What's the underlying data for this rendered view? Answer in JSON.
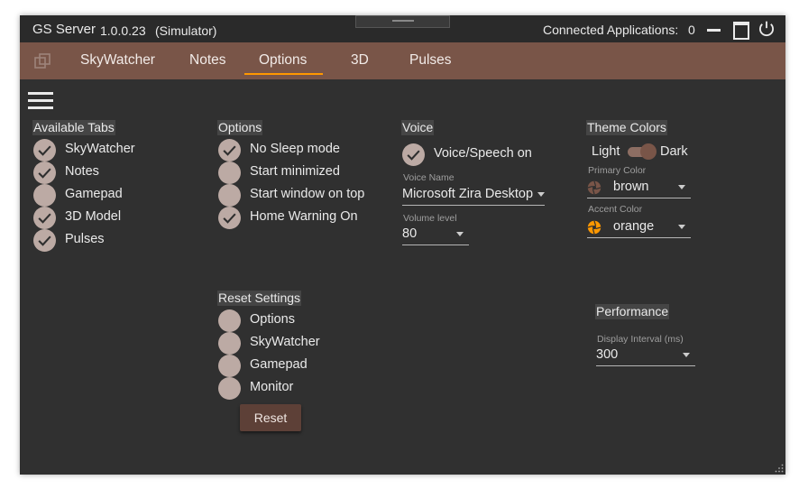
{
  "titlebar": {
    "app_name": "GS Server",
    "version": "1.0.0.23",
    "mode": "(Simulator)",
    "connected_label": "Connected Applications:",
    "connected_count": "0"
  },
  "tabs": [
    {
      "label": "SkyWatcher",
      "selected": false
    },
    {
      "label": "Notes",
      "selected": false
    },
    {
      "label": "Options",
      "selected": true
    },
    {
      "label": "3D",
      "selected": false
    },
    {
      "label": "Pulses",
      "selected": false
    }
  ],
  "available_tabs": {
    "header": "Available Tabs",
    "items": [
      {
        "label": "SkyWatcher",
        "checked": true
      },
      {
        "label": "Notes",
        "checked": true
      },
      {
        "label": "Gamepad",
        "checked": false
      },
      {
        "label": "3D Model",
        "checked": true
      },
      {
        "label": "Pulses",
        "checked": true
      }
    ]
  },
  "options": {
    "header": "Options",
    "items": [
      {
        "label": "No Sleep mode",
        "checked": true
      },
      {
        "label": "Start minimized",
        "checked": false
      },
      {
        "label": "Start window on top",
        "checked": false
      },
      {
        "label": "Home Warning On",
        "checked": true
      }
    ]
  },
  "voice": {
    "header": "Voice",
    "speech_label": "Voice/Speech on",
    "speech_checked": true,
    "voice_name_label": "Voice Name",
    "voice_name_value": "Microsoft Zira Desktop",
    "volume_label": "Volume level",
    "volume_value": "80"
  },
  "theme": {
    "header": "Theme Colors",
    "light_label": "Light",
    "dark_label": "Dark",
    "primary_label": "Primary Color",
    "primary_value": "brown",
    "primary_swatch": "#795548",
    "accent_label": "Accent Color",
    "accent_value": "orange",
    "accent_swatch": "#ff9800"
  },
  "reset_settings": {
    "header": "Reset Settings",
    "items": [
      {
        "label": "Options",
        "checked": false
      },
      {
        "label": "SkyWatcher",
        "checked": false
      },
      {
        "label": "Gamepad",
        "checked": false
      },
      {
        "label": "Monitor",
        "checked": false
      }
    ],
    "button_label": "Reset"
  },
  "performance": {
    "header": "Performance",
    "interval_label": "Display Interval (ms)",
    "interval_value": "300"
  },
  "colors": {
    "accent": "#ff9800",
    "tab_bar": "#795548",
    "checkbox": "#bcaaa4"
  }
}
